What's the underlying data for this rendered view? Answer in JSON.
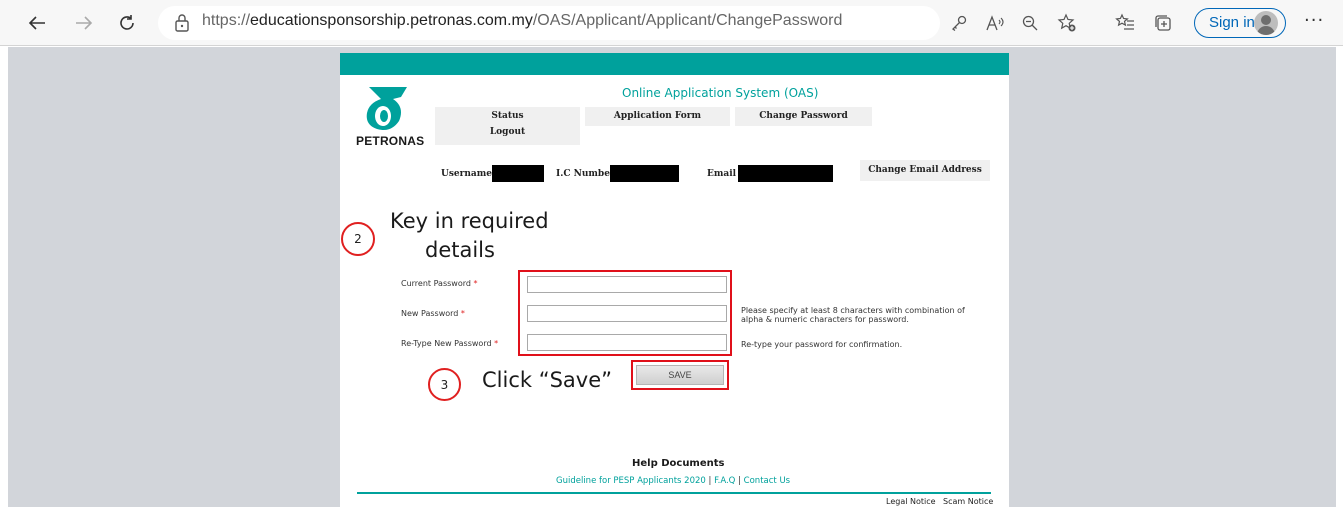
{
  "browser": {
    "url_prefix": "https://",
    "url_host": "educationsponsorship.petronas.com.my",
    "url_path": "/OAS/Applicant/Applicant/ChangePassword",
    "signin_label": "Sign in",
    "icons": [
      "back-icon",
      "forward-icon",
      "refresh-icon",
      "lock-icon",
      "key-icon",
      "read-aloud-icon",
      "zoom-icon",
      "favorite-add-icon",
      "favorites-icon",
      "collections-icon",
      "profile-avatar",
      "more-icon"
    ]
  },
  "header": {
    "logo_text": "PETRONAS",
    "system_title": "Online Application System (OAS)",
    "menu": {
      "status": "Status",
      "logout": "Logout",
      "application_form": "Application Form",
      "change_password": "Change Password"
    }
  },
  "user_info": {
    "username_label": "Username :",
    "ic_label": "I.C Number :",
    "email_label": "Email :",
    "change_email_label": "Change Email Address"
  },
  "annotations": {
    "step2_number": "2",
    "step2_line1": "Key in required",
    "step2_line2": "details",
    "step3_number": "3",
    "step3_text": "Click “Save”"
  },
  "form": {
    "required_mark": "*",
    "current_password_label": "Current Password",
    "new_password_label": "New Password",
    "retype_password_label": "Re-Type New Password",
    "current_password_value": "",
    "new_password_value": "",
    "retype_password_value": "",
    "new_password_hint_line1": "Please specify at least 8 characters with combination of",
    "new_password_hint_line2": "alpha & numeric characters for password.",
    "retype_hint": "Re-type your password for confirmation.",
    "save_label": "SAVE"
  },
  "footer": {
    "help_title": "Help Documents",
    "links": {
      "guideline": "Guideline for PESP Applicants 2020",
      "separator": "|",
      "faq": "F.A.Q",
      "contact": "Contact Us"
    },
    "legal_notice": "Legal Notice",
    "scam_notice": "Scam Notice"
  },
  "colors": {
    "brand_teal": "#00a19c",
    "annotation_red": "#e02020",
    "page_background": "#d2d5da"
  }
}
